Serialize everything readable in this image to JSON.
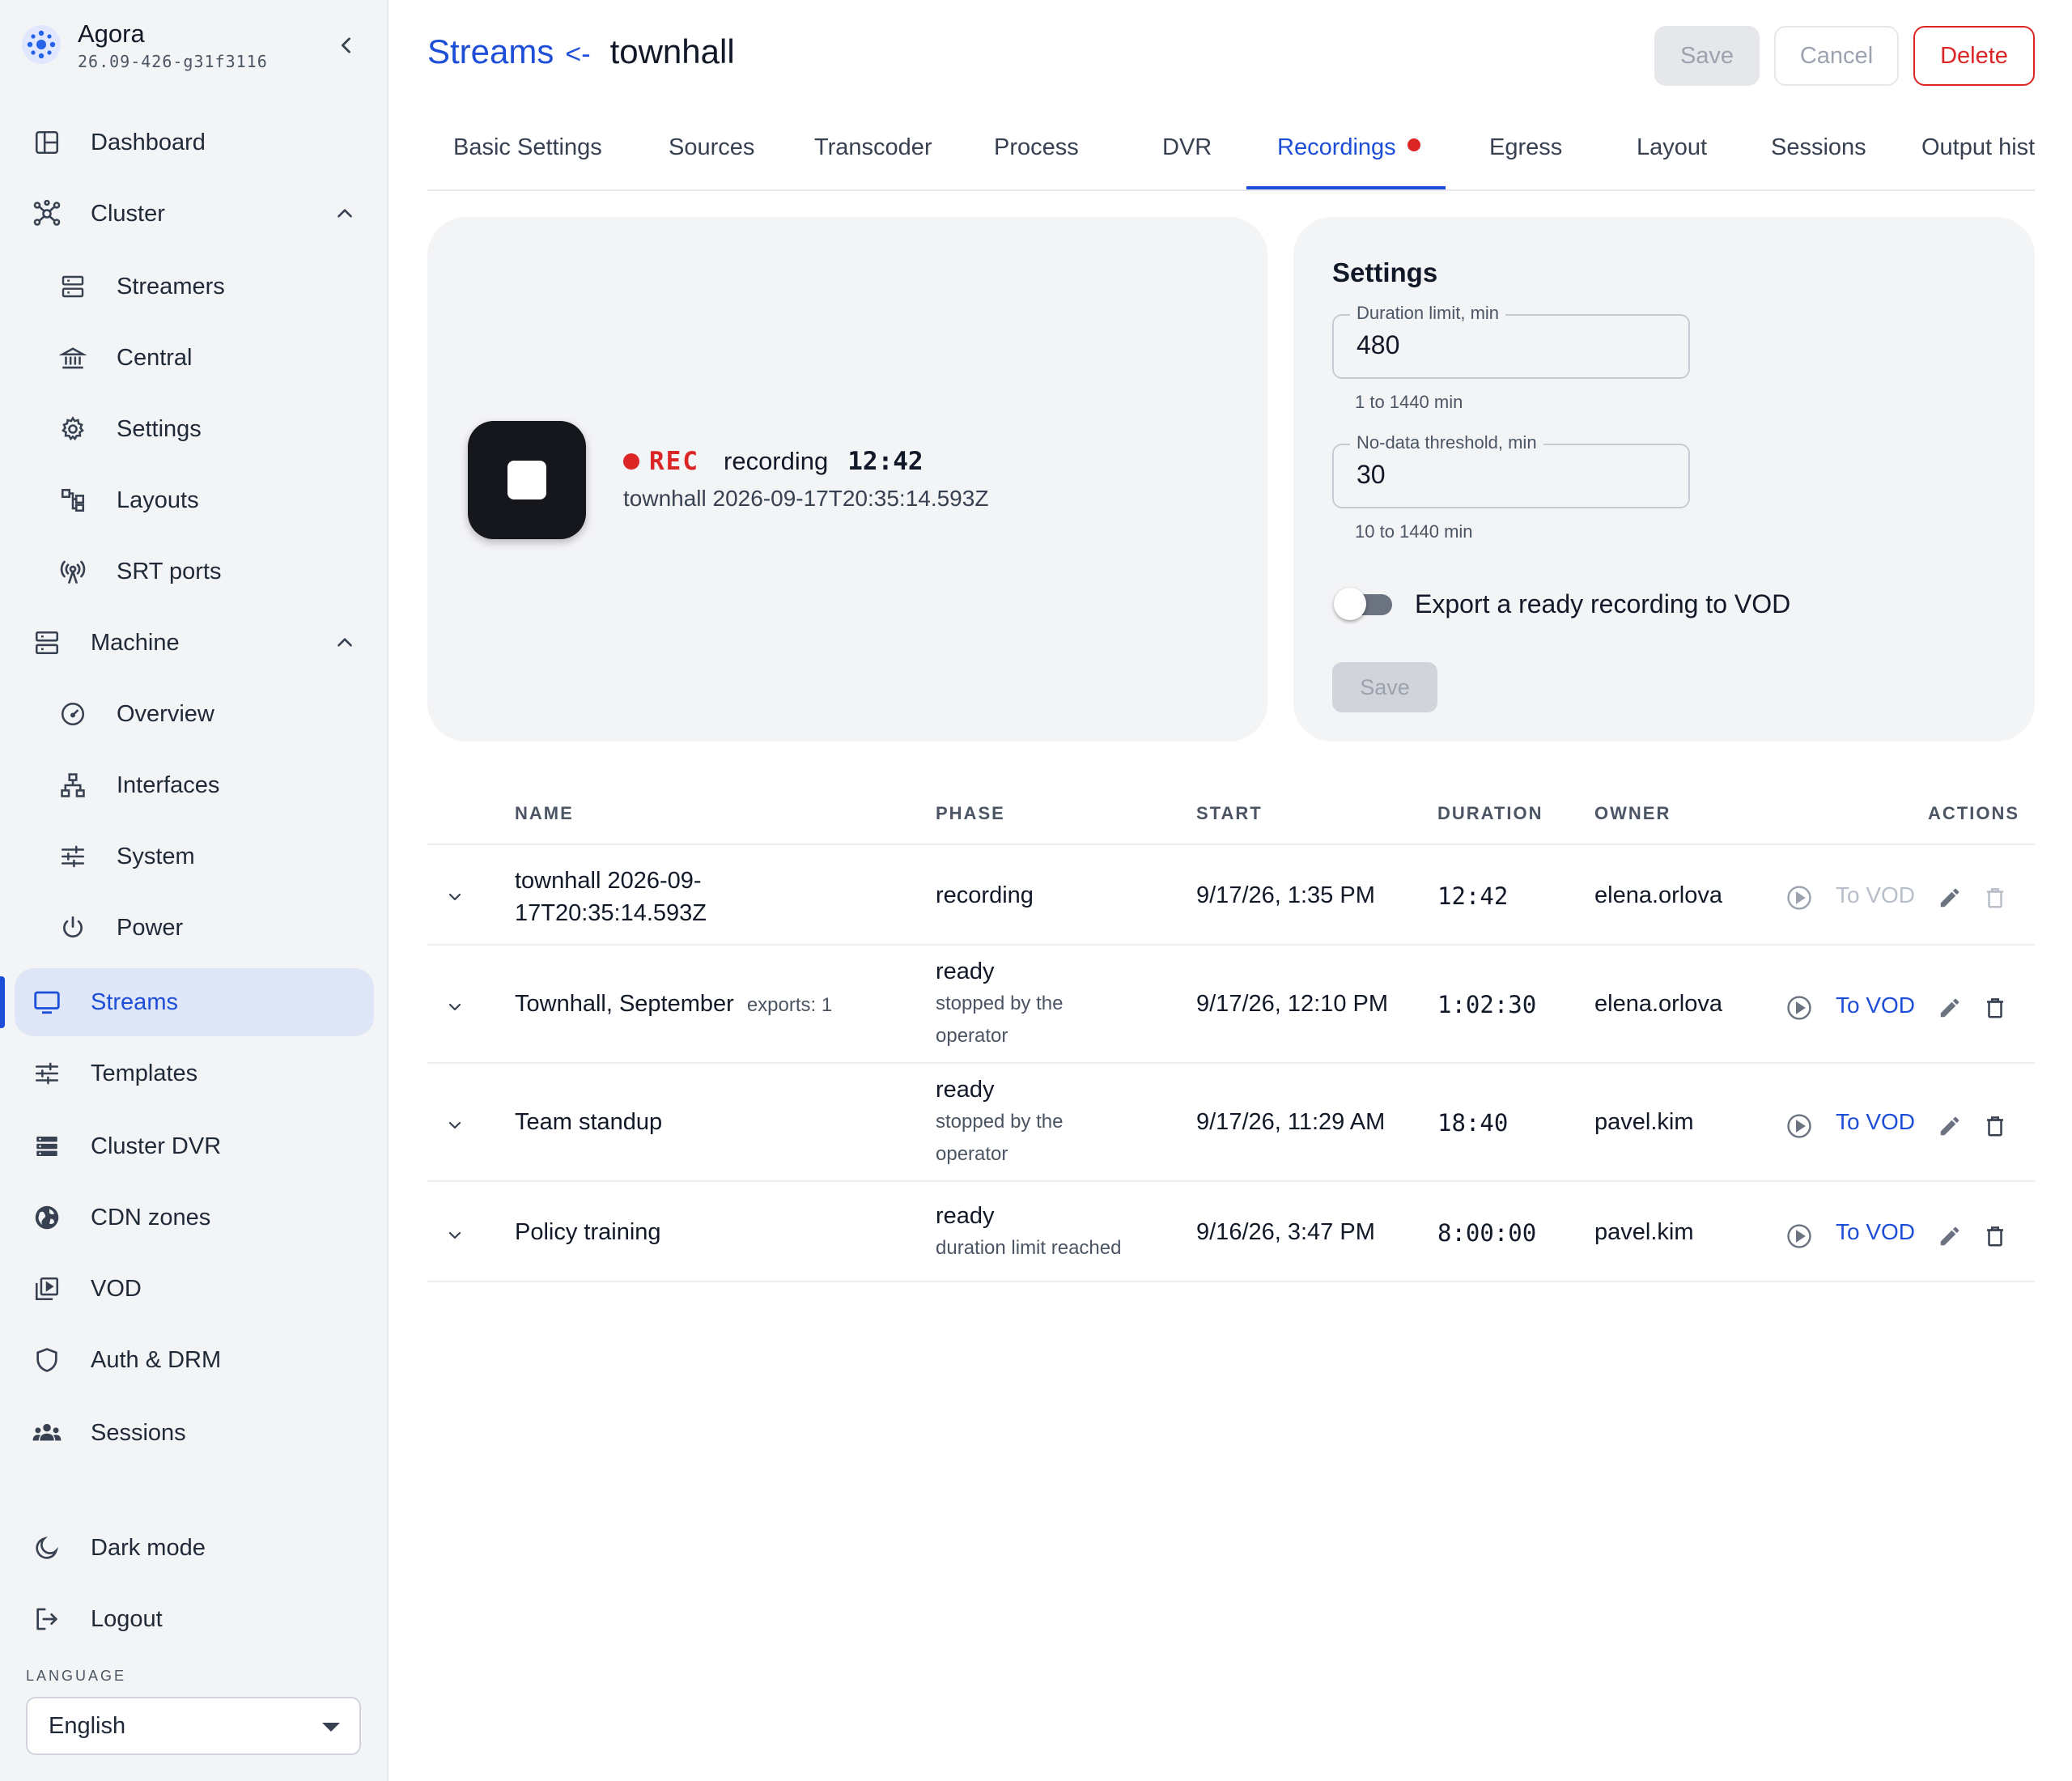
{
  "app": {
    "name": "Agora",
    "version": "26.09-426-g31f3116"
  },
  "sidebar": {
    "items": [
      {
        "label": "Dashboard",
        "icon": "dashboard-icon"
      },
      {
        "label": "Cluster",
        "icon": "cluster-icon",
        "expanded": true
      },
      {
        "label": "Streamers",
        "icon": "server-icon"
      },
      {
        "label": "Central",
        "icon": "bank-icon"
      },
      {
        "label": "Settings",
        "icon": "gear-icon"
      },
      {
        "label": "Layouts",
        "icon": "layouts-icon"
      },
      {
        "label": "SRT ports",
        "icon": "antenna-icon"
      },
      {
        "label": "Machine",
        "icon": "machine-icon",
        "expanded": true
      },
      {
        "label": "Overview",
        "icon": "speedometer-icon"
      },
      {
        "label": "Interfaces",
        "icon": "network-icon"
      },
      {
        "label": "System",
        "icon": "sliders-icon"
      },
      {
        "label": "Power",
        "icon": "power-icon"
      },
      {
        "label": "Streams",
        "icon": "monitor-icon",
        "active": true
      },
      {
        "label": "Templates",
        "icon": "sliders-icon"
      },
      {
        "label": "Cluster DVR",
        "icon": "storage-icon"
      },
      {
        "label": "CDN zones",
        "icon": "globe-icon"
      },
      {
        "label": "VOD",
        "icon": "video-library-icon"
      },
      {
        "label": "Auth & DRM",
        "icon": "shield-icon"
      },
      {
        "label": "Sessions",
        "icon": "users-icon"
      }
    ],
    "dark_mode": "Dark mode",
    "logout": "Logout",
    "language_label": "LANGUAGE",
    "language_value": "English"
  },
  "header": {
    "breadcrumb_link": "Streams",
    "breadcrumb_arrow": "<-",
    "stream_name": "townhall",
    "save_label": "Save",
    "cancel_label": "Cancel",
    "delete_label": "Delete"
  },
  "tabs": [
    {
      "label": "Basic Settings"
    },
    {
      "label": "Sources"
    },
    {
      "label": "Transcoder"
    },
    {
      "label": "Process"
    },
    {
      "label": "DVR"
    },
    {
      "label": "Recordings",
      "active": true,
      "badge": "red-dot"
    },
    {
      "label": "Egress"
    },
    {
      "label": "Layout"
    },
    {
      "label": "Sessions"
    },
    {
      "label": "Output hist"
    }
  ],
  "recorder": {
    "rec_label": "REC",
    "phase": "recording",
    "elapsed": "12:42",
    "name": "townhall 2026-09-17T20:35:14.593Z"
  },
  "settings": {
    "title": "Settings",
    "duration_label": "Duration limit, min",
    "duration_value": "480",
    "duration_hint": "1 to 1440 min",
    "nodata_label": "No-data threshold, min",
    "nodata_value": "30",
    "nodata_hint": "10 to 1440 min",
    "export_label": "Export a ready recording to VOD",
    "export_enabled": false,
    "save_label": "Save"
  },
  "table": {
    "columns": [
      "NAME",
      "PHASE",
      "START",
      "DURATION",
      "OWNER",
      "ACTIONS"
    ],
    "to_vod_label": "To VOD",
    "rows": [
      {
        "name_line1": "townhall 2026-09-",
        "name_line2": "17T20:35:14.593Z",
        "exports": "",
        "phase": "recording",
        "phase_detail_1": "",
        "phase_detail_2": "",
        "start": "9/17/26, 1:35 PM",
        "duration": "12:42",
        "owner": "elena.orlova",
        "actions_enabled": false
      },
      {
        "name_line1": "Townhall, September",
        "name_line2": "",
        "exports": "exports: 1",
        "phase": "ready",
        "phase_detail_1": "stopped by the",
        "phase_detail_2": "operator",
        "start": "9/17/26, 12:10 PM",
        "duration": "1:02:30",
        "owner": "elena.orlova",
        "actions_enabled": true
      },
      {
        "name_line1": "Team standup",
        "name_line2": "",
        "exports": "",
        "phase": "ready",
        "phase_detail_1": "stopped by the",
        "phase_detail_2": "operator",
        "start": "9/17/26, 11:29 AM",
        "duration": "18:40",
        "owner": "pavel.kim",
        "actions_enabled": true
      },
      {
        "name_line1": "Policy training",
        "name_line2": "",
        "exports": "",
        "phase": "ready",
        "phase_detail_1": "duration limit reached",
        "phase_detail_2": "",
        "start": "9/16/26, 3:47 PM",
        "duration": "8:00:00",
        "owner": "pavel.kim",
        "actions_enabled": true
      }
    ]
  },
  "colors": {
    "accent": "#1d4ed8",
    "danger": "#dc2626",
    "sidebar_bg": "#f3f4f6",
    "active_nav_bg": "#dfe6f7"
  }
}
